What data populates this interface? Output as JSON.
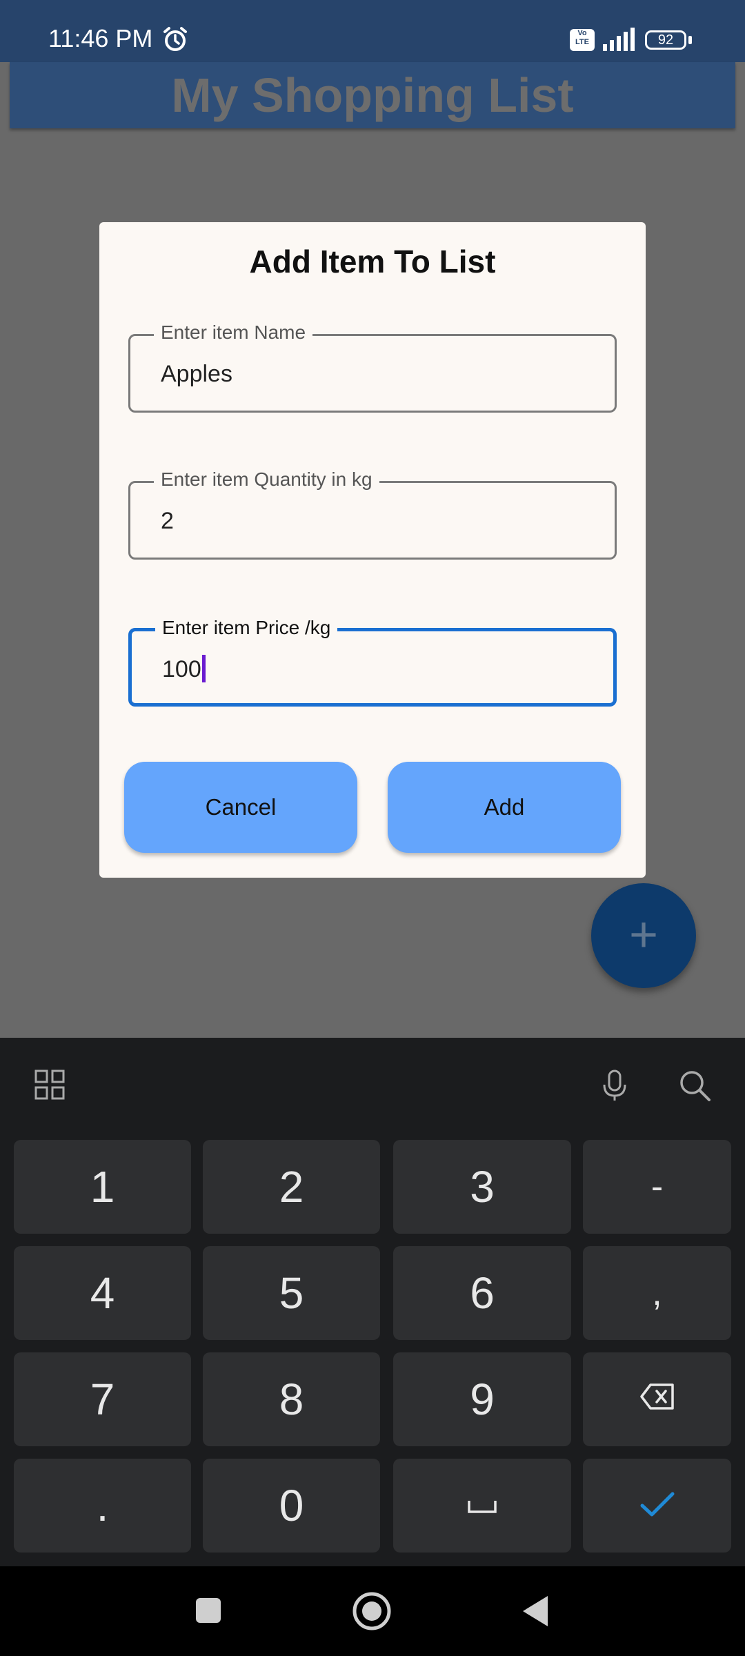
{
  "status_bar": {
    "time": "11:46 PM",
    "battery": "92",
    "volte": "Vo LTE"
  },
  "app_bar": {
    "title": "My Shopping List"
  },
  "fab": {
    "icon": "+"
  },
  "dialog": {
    "title": "Add Item To List",
    "fields": [
      {
        "label": "Enter item Name",
        "value": "Apples"
      },
      {
        "label": "Enter item Quantity in kg",
        "value": "2"
      },
      {
        "label": "Enter item Price /kg",
        "value": "100"
      }
    ],
    "cancel_label": "Cancel",
    "add_label": "Add"
  },
  "keyboard": {
    "keys": [
      "1",
      "2",
      "3",
      "-",
      "4",
      "5",
      "6",
      ",",
      "7",
      "8",
      "9",
      ".",
      "0"
    ]
  },
  "colors": {
    "accent": "#1a6fd1",
    "button": "#64a5fc",
    "status_bar": "#27446b",
    "check": "#1f8ad6"
  }
}
